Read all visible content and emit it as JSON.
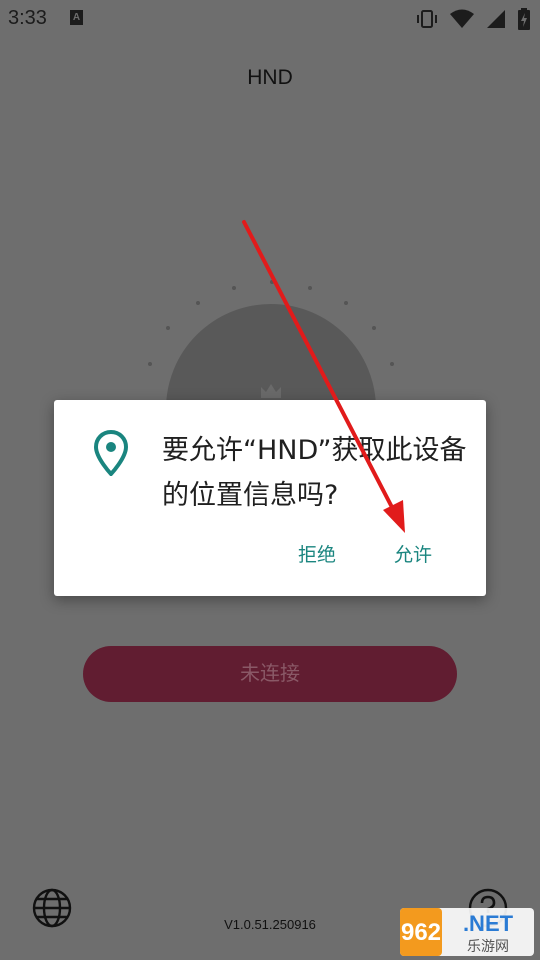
{
  "status_bar": {
    "time": "3:33",
    "notification_letter": "A",
    "icons": [
      "vibrate-icon",
      "wifi-icon",
      "cell-signal-icon",
      "battery-charging-icon"
    ]
  },
  "app": {
    "title": "HND",
    "connect_label": "未连接",
    "version": "V1.0.51.250916",
    "icons": [
      "crown-icon",
      "globe-icon",
      "help-icon"
    ]
  },
  "dialog": {
    "message": "要允许“HND”获取此设备的位置信息吗?",
    "deny_label": "拒绝",
    "allow_label": "允许",
    "icon": "location-pin-icon",
    "accent_color": "#1a857f"
  },
  "annotation": {
    "type": "arrow",
    "color": "#e11b1b",
    "points_to": "allow-button"
  },
  "watermark": {
    "brand_number": "962",
    "brand_suffix": ".NET",
    "tagline": "乐游网"
  },
  "colors": {
    "scrim_background": "#6e6e6e",
    "connect_button": "#611d31"
  }
}
